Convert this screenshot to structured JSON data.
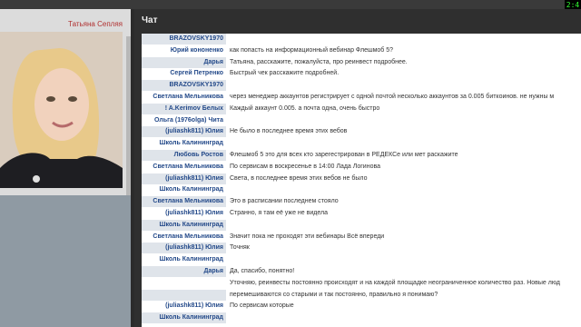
{
  "window": {
    "title": "Чат",
    "top_left_label": "",
    "top_right_label": "",
    "clock": "2:4"
  },
  "presenter": {
    "name": "Татьяна Сепляя"
  },
  "messages": [
    {
      "name": "BRAZOVSKY1970",
      "text": ""
    },
    {
      "name": "Юрий кононенко",
      "text": "как попасть на информационный вебинар Флешмоб 5?"
    },
    {
      "name": "Дарья",
      "text": "Татьяна, расскажите, пожалуйста, про реинвест подробнее."
    },
    {
      "name": "Сергей Петренко",
      "text": "Быстрый чек расскажите подробней."
    },
    {
      "name": "BRAZOVSKY1970",
      "text": ""
    },
    {
      "name": "Светлана Мельникова",
      "text": "через менеджер аккаунтов регистрирует с одной почтой несколько аккаунтов за 0.005 биткоинов. не нужны м"
    },
    {
      "name": "! A.Kerimov Белых",
      "text": "Каждый аккаунт 0.005. а почта одна, очень быстро"
    },
    {
      "name": "Ольга (1976olga) Чита",
      "text": ""
    },
    {
      "name": "(juliashk811) Юлия",
      "text": "Не было в последнее время этих вебов"
    },
    {
      "name": "Школь Калининград",
      "text": ""
    },
    {
      "name": "Любовь Ростов",
      "text": "Флешмоб 5 это для всех кто зарегестрирован в РЕДЕКСе или мет раскажите"
    },
    {
      "name": "Светлана Мельникова",
      "text": "По сервисам в воскресенье в 14:00 Лада Логинова"
    },
    {
      "name": "(juliashk811) Юлия",
      "text": "Света, в последнее время этих вебов не было"
    },
    {
      "name": "Школь Калининград",
      "text": ""
    },
    {
      "name": "Светлана Мельникова",
      "text": "Это в расписании последнем стояло"
    },
    {
      "name": "(juliashk811) Юлия",
      "text": "Странно, я там её уже не видела"
    },
    {
      "name": "Школь Калининград",
      "text": ""
    },
    {
      "name": "Светлана Мельникова",
      "text": "Значит пока не проходят эти вебинары Всё впереди"
    },
    {
      "name": "(juliashk811) Юлия",
      "text": "Точняк"
    },
    {
      "name": "Школь Калининград",
      "text": ""
    },
    {
      "name": "Дарья",
      "text": "Да, спасибо, понятно!"
    },
    {
      "name": "",
      "text": "Уточняю, реинвесты постоянно происходят и на каждой площадке неограниченное количество раз. Новые люд"
    },
    {
      "name": "",
      "text": "перемешиваются со старыми и так постоянно, правильно я понимаю?"
    },
    {
      "name": "(juliashk811) Юлия",
      "text": "По сервисам которые"
    },
    {
      "name": "Школь Калининград",
      "text": ""
    }
  ]
}
